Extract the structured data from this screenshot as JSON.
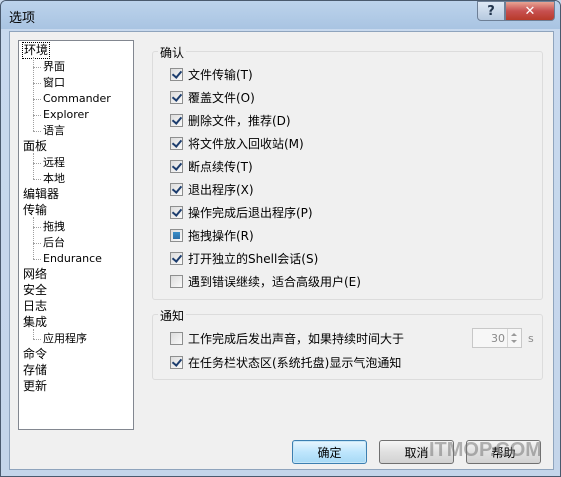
{
  "window": {
    "title": "选项"
  },
  "titlebar": {
    "help_glyph": "?",
    "close_glyph": "✕"
  },
  "tree": {
    "items": [
      {
        "label": "环境",
        "level": 0,
        "selected": true
      },
      {
        "label": "界面",
        "level": 1
      },
      {
        "label": "窗口",
        "level": 1
      },
      {
        "label": "Commander",
        "level": 1
      },
      {
        "label": "Explorer",
        "level": 1
      },
      {
        "label": "语言",
        "level": 1
      },
      {
        "label": "面板",
        "level": 0
      },
      {
        "label": "远程",
        "level": 1
      },
      {
        "label": "本地",
        "level": 1
      },
      {
        "label": "编辑器",
        "level": 0
      },
      {
        "label": "传输",
        "level": 0
      },
      {
        "label": "拖拽",
        "level": 1
      },
      {
        "label": "后台",
        "level": 1
      },
      {
        "label": "Endurance",
        "level": 1
      },
      {
        "label": "网络",
        "level": 0
      },
      {
        "label": "安全",
        "level": 0
      },
      {
        "label": "日志",
        "level": 0
      },
      {
        "label": "集成",
        "level": 0
      },
      {
        "label": "应用程序",
        "level": 1
      },
      {
        "label": "命令",
        "level": 0
      },
      {
        "label": "存储",
        "level": 0
      },
      {
        "label": "更新",
        "level": 0
      }
    ]
  },
  "confirm_group": {
    "title": "确认",
    "items": [
      {
        "label": "文件传输(T)",
        "state": "checked"
      },
      {
        "label": "覆盖文件(O)",
        "state": "checked"
      },
      {
        "label": "删除文件，推荐(D)",
        "state": "checked"
      },
      {
        "label": "将文件放入回收站(M)",
        "state": "checked"
      },
      {
        "label": "断点续传(T)",
        "state": "checked"
      },
      {
        "label": "退出程序(X)",
        "state": "checked"
      },
      {
        "label": "操作完成后退出程序(P)",
        "state": "checked"
      },
      {
        "label": "拖拽操作(R)",
        "state": "indeterminate"
      },
      {
        "label": "打开独立的Shell会话(S)",
        "state": "checked"
      },
      {
        "label": "遇到错误继续，适合高级用户(E)",
        "state": "unchecked"
      }
    ]
  },
  "notify_group": {
    "title": "通知",
    "sound_label": "工作完成后发出声音，如果持续时间大于",
    "sound_checked": false,
    "sound_seconds": "30",
    "sound_unit": "s",
    "tray_label": "在任务栏状态区(系统托盘)显示气泡通知",
    "tray_checked": true
  },
  "buttons": {
    "ok": "确定",
    "cancel": "取消",
    "help": "帮助"
  },
  "watermark": "ITMOP.COM"
}
